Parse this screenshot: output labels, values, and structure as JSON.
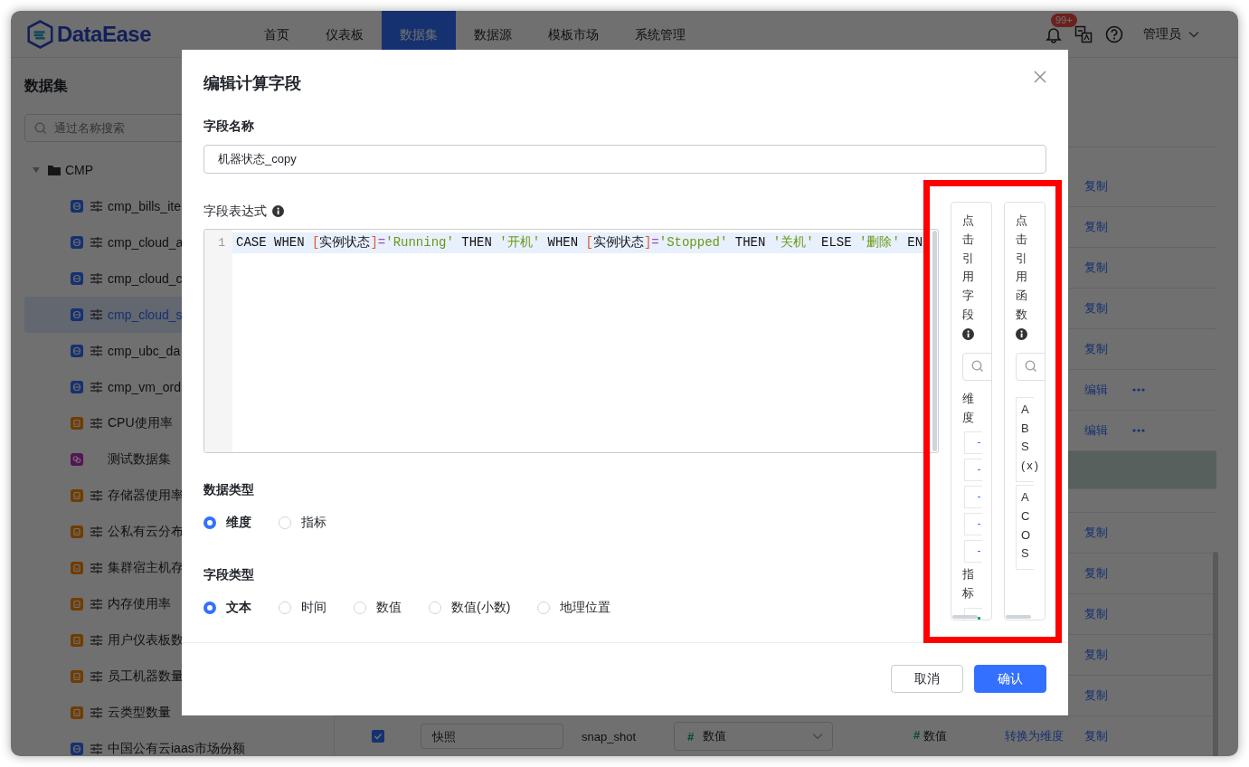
{
  "header": {
    "logo": "DataEase",
    "nav": [
      {
        "label": "首页",
        "selected": false
      },
      {
        "label": "仪表板",
        "selected": false
      },
      {
        "label": "数据集",
        "selected": true
      },
      {
        "label": "数据源",
        "selected": false
      },
      {
        "label": "模板市场",
        "selected": false
      },
      {
        "label": "系统管理",
        "selected": false
      }
    ],
    "badge": "99+",
    "user": "管理员"
  },
  "sidebar": {
    "title": "数据集",
    "search": {
      "placeholder": "通过名称搜索"
    },
    "tree": [
      {
        "label": "CMP",
        "expanded": true,
        "children": [
          {
            "label": "cmp_bills_ite",
            "kind": "api",
            "selected": false
          },
          {
            "label": "cmp_cloud_a",
            "kind": "api",
            "selected": false
          },
          {
            "label": "cmp_cloud_c",
            "kind": "api",
            "selected": false
          },
          {
            "label": "cmp_cloud_s",
            "kind": "api",
            "selected": true
          },
          {
            "label": "cmp_ubc_da",
            "kind": "api",
            "selected": false
          },
          {
            "label": "cmp_vm_ord",
            "kind": "api",
            "selected": false
          },
          {
            "label": "CPU使用率",
            "kind": "excel",
            "selected": false
          },
          {
            "label": "测试数据集",
            "kind": "union",
            "selected": false
          },
          {
            "label": "存储器使用率",
            "kind": "excel",
            "selected": false
          },
          {
            "label": "公私有云分布",
            "kind": "excel",
            "selected": false
          },
          {
            "label": "集群宿主机存",
            "kind": "excel",
            "selected": false
          },
          {
            "label": "内存使用率",
            "kind": "excel",
            "selected": false
          },
          {
            "label": "用户仪表板数",
            "kind": "excel",
            "selected": false
          },
          {
            "label": "员工机器数量",
            "kind": "excel",
            "selected": false
          },
          {
            "label": "云类型数量",
            "kind": "excel",
            "selected": false
          },
          {
            "label": "中国公有云iaas市场份额",
            "kind": "api",
            "selected": false
          }
        ]
      }
    ]
  },
  "table": {
    "rows": [
      {
        "kind": "action",
        "selected": false,
        "action": "复制"
      },
      {
        "kind": "action",
        "selected": false,
        "action": "复制"
      },
      {
        "kind": "action",
        "selected": false,
        "action": "复制"
      },
      {
        "kind": "action",
        "selected": false,
        "action": "复制"
      },
      {
        "kind": "action",
        "selected": false,
        "action": "复制"
      },
      {
        "kind": "action",
        "selected": false,
        "action": "编辑",
        "more": true
      },
      {
        "kind": "action",
        "selected": false,
        "action": "编辑",
        "more": true
      },
      {
        "kind": "blank",
        "selected": true
      },
      {
        "kind": "blank",
        "selected": false
      },
      {
        "kind": "action",
        "selected": false,
        "action": "复制"
      },
      {
        "kind": "action",
        "selected": false,
        "action": "复制"
      },
      {
        "kind": "action",
        "selected": false,
        "action": "复制"
      },
      {
        "kind": "action",
        "selected": false,
        "action": "复制"
      },
      {
        "kind": "action",
        "selected": false,
        "action": "复制"
      },
      {
        "kind": "field",
        "selected": false,
        "checked": true,
        "name": "快照",
        "origin": "snap_shot",
        "type": {
          "symbol": "#",
          "label": "数值"
        },
        "display": {
          "symbol": "#",
          "label": "数值"
        },
        "convert": "转换为维度",
        "action": "复制"
      }
    ]
  },
  "dialog": {
    "title": "编辑计算字段",
    "name_label": "字段名称",
    "name_value": "机器状态_copy",
    "expression_label": "字段表达式",
    "expression": {
      "lines": [
        {
          "number": "1",
          "tokens": [
            {
              "kind": "keyword",
              "text": "CASE WHEN "
            },
            {
              "kind": "bracket",
              "text": "["
            },
            {
              "kind": "plain",
              "text": "实例状态"
            },
            {
              "kind": "bracket",
              "text": "]"
            },
            {
              "kind": "operator",
              "text": "="
            },
            {
              "kind": "string",
              "text": "'Running'"
            },
            {
              "kind": "keyword",
              "text": " THEN "
            },
            {
              "kind": "string",
              "text": "'开机'"
            },
            {
              "kind": "keyword",
              "text": " WHEN "
            },
            {
              "kind": "bracket",
              "text": "["
            },
            {
              "kind": "plain",
              "text": "实例状态"
            },
            {
              "kind": "bracket",
              "text": "]"
            },
            {
              "kind": "operator",
              "text": "="
            },
            {
              "kind": "string",
              "text": "'Stopped'"
            },
            {
              "kind": "keyword",
              "text": " THEN "
            },
            {
              "kind": "string",
              "text": "'关机'"
            },
            {
              "kind": "keyword",
              "text": " ELSE "
            },
            {
              "kind": "string",
              "text": "'删除'"
            },
            {
              "kind": "keyword",
              "text": " EN"
            }
          ]
        }
      ]
    },
    "field_panel": {
      "title": "点击引用字段",
      "groups": [
        {
          "title": "维度",
          "items": [
            {
              "kind": "text"
            },
            {
              "kind": "text"
            },
            {
              "kind": "text"
            },
            {
              "kind": "text"
            },
            {
              "kind": "text"
            }
          ]
        },
        {
          "title": "指标",
          "items": [
            {
              "kind": "number"
            }
          ]
        }
      ]
    },
    "function_panel": {
      "title": "点击引用函数",
      "items": [
        {
          "label": "ABS(x)"
        },
        {
          "label": "ACOS"
        }
      ]
    },
    "data_type": {
      "label": "数据类型",
      "options": [
        {
          "label": "维度",
          "selected": true
        },
        {
          "label": "指标",
          "selected": false
        }
      ]
    },
    "field_type": {
      "label": "字段类型",
      "options": [
        {
          "label": "文本",
          "selected": true
        },
        {
          "label": "时间",
          "selected": false
        },
        {
          "label": "数值",
          "selected": false
        },
        {
          "label": "数值(小数)",
          "selected": false
        },
        {
          "label": "地理位置",
          "selected": false
        }
      ]
    },
    "buttons": [
      {
        "label": "取消",
        "kind": "secondary"
      },
      {
        "label": "确认",
        "kind": "primary"
      }
    ]
  }
}
